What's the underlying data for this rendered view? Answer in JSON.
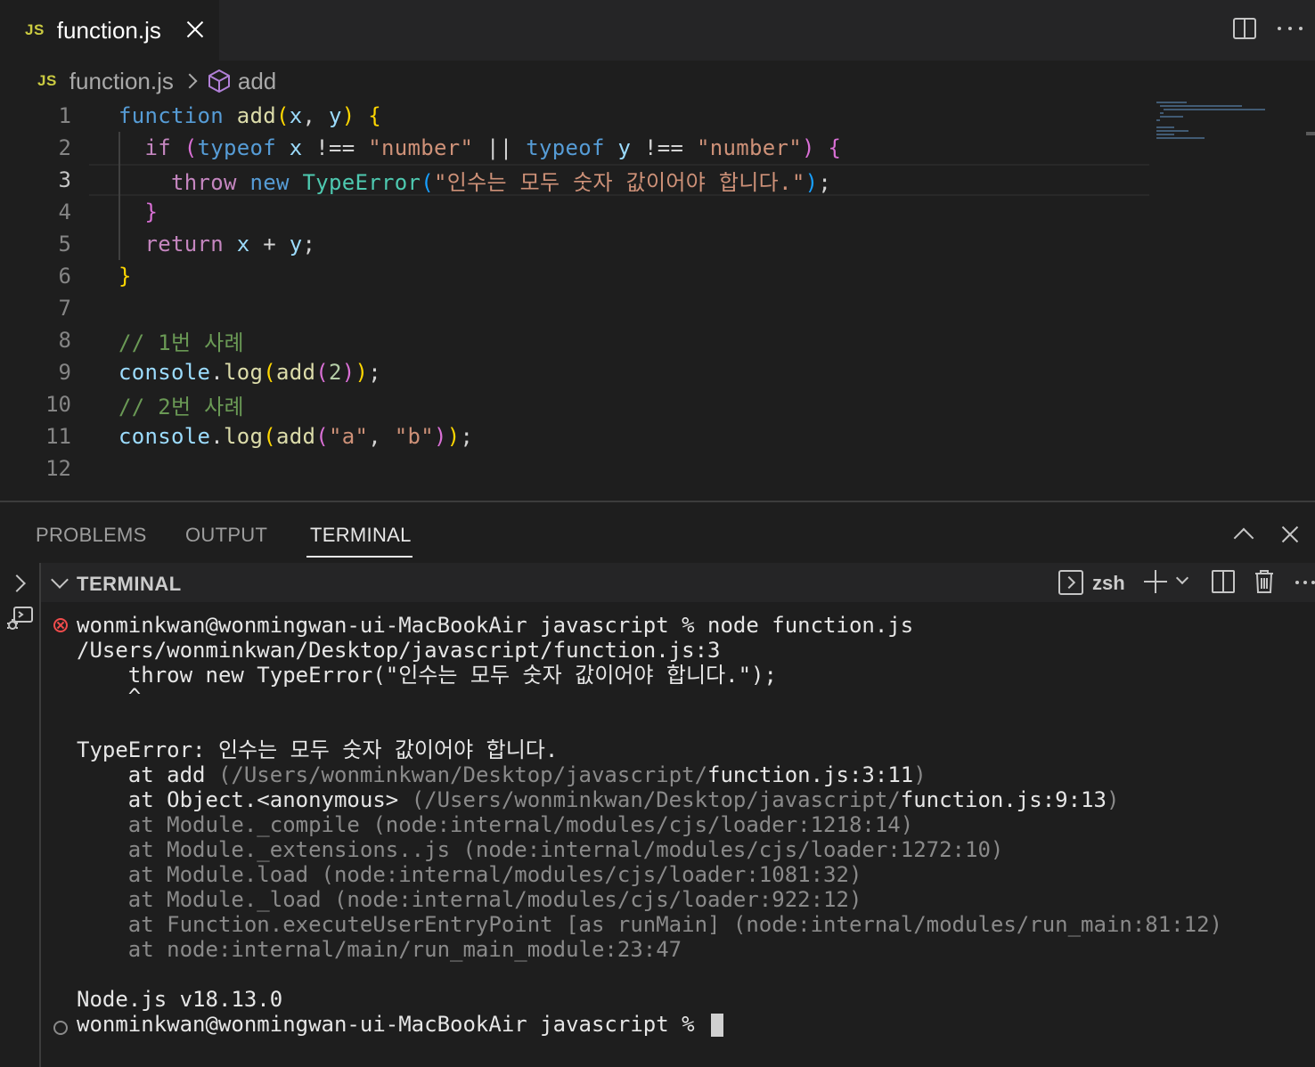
{
  "tab": {
    "badge": "JS",
    "title": "function.js"
  },
  "breadcrumb": {
    "badge": "JS",
    "file": "function.js",
    "symbol": "add"
  },
  "editor": {
    "lines": [
      "1",
      "2",
      "3",
      "4",
      "5",
      "6",
      "7",
      "8",
      "9",
      "10",
      "11",
      "12"
    ],
    "active_line": "3",
    "code": {
      "l1": {
        "kw": "function",
        "fn": "add",
        "p1": "(",
        "x": "x",
        "comma": ", ",
        "y": "y",
        "p2": ")",
        "sp": " ",
        "brace": "{"
      },
      "l2": {
        "indent": "  ",
        "if": "if",
        "sp": " ",
        "p1": "(",
        "typeof1": "typeof",
        "x": "x",
        "op1": " !== ",
        "str1": "\"number\"",
        "or": " || ",
        "typeof2": "typeof",
        "y": "y",
        "op2": " !== ",
        "str2": "\"number\"",
        "p2": ")",
        "brace": "{"
      },
      "l3": {
        "indent": "    ",
        "throw": "throw",
        "new": "new",
        "cls": "TypeError",
        "p1": "(",
        "str": "\"인수는 모두 숫자 값이어야 합니다.\"",
        "p2": ")",
        "semi": ";"
      },
      "l4": {
        "indent": "  ",
        "brace": "}"
      },
      "l5": {
        "indent": "  ",
        "ret": "return",
        "x": "x",
        "plus": " + ",
        "y": "y",
        "semi": ";"
      },
      "l6": {
        "brace": "}"
      },
      "l8": {
        "comment": "// 1번 사례"
      },
      "l9": {
        "obj": "console",
        "dot": ".",
        "log": "log",
        "p1": "(",
        "add": "add",
        "p2": "(",
        "num": "2",
        "p3": ")",
        "p4": ")",
        "semi": ";"
      },
      "l10": {
        "comment": "// 2번 사례"
      },
      "l11": {
        "obj": "console",
        "dot": ".",
        "log": "log",
        "p1": "(",
        "add": "add",
        "p2": "(",
        "a": "\"a\"",
        "comma": ", ",
        "b": "\"b\"",
        "p3": ")",
        "p4": ")",
        "semi": ";"
      }
    }
  },
  "panel": {
    "tabs": [
      "PROBLEMS",
      "OUTPUT",
      "TERMINAL"
    ],
    "active_tab": "TERMINAL",
    "terminal_title": "TERMINAL",
    "shell": "zsh"
  },
  "terminal": {
    "prompt1": "wonminkwan@wonmingwan-ui-MacBookAir javascript % node function.js",
    "path": "/Users/wonminkwan/Desktop/javascript/function.js:3",
    "code_line": "    throw new TypeError(\"인수는 모두 숫자 값이어야 합니다.\");",
    "caret": "    ^",
    "error": "TypeError: 인수는 모두 숫자 값이어야 합니다.",
    "stack": [
      {
        "pre": "    at add ",
        "dim": "(/Users/wonminkwan/Desktop/javascript/",
        "bright": "function.js:3:11",
        "end": ")"
      },
      {
        "pre": "    at Object.<anonymous> ",
        "dim": "(/Users/wonminkwan/Desktop/javascript/",
        "bright": "function.js:9:13",
        "end": ")"
      },
      {
        "dim_full": "    at Module._compile (node:internal/modules/cjs/loader:1218:14)"
      },
      {
        "dim_full": "    at Module._extensions..js (node:internal/modules/cjs/loader:1272:10)"
      },
      {
        "dim_full": "    at Module.load (node:internal/modules/cjs/loader:1081:32)"
      },
      {
        "dim_full": "    at Module._load (node:internal/modules/cjs/loader:922:12)"
      },
      {
        "dim_full": "    at Function.executeUserEntryPoint [as runMain] (node:internal/modules/run_main:81:12)"
      },
      {
        "dim_full": "    at node:internal/main/run_main_module:23:47"
      }
    ],
    "node_version": "Node.js v18.13.0",
    "prompt2": "wonminkwan@wonmingwan-ui-MacBookAir javascript % "
  },
  "colors": {
    "keyword": "#569cd6",
    "control": "#c586c0",
    "function": "#dcdcaa",
    "variable": "#9cdcfe",
    "string": "#ce9178",
    "number": "#b5cea8",
    "class": "#4ec9b0",
    "comment": "#6a9955",
    "error": "#f14c4c"
  },
  "icons": [
    "js-file-icon",
    "close-icon",
    "split-editor-icon",
    "more-icon",
    "chevron-right-icon",
    "symbol-method-icon",
    "chevron-up-icon",
    "terminal-shell-icon",
    "plus-icon",
    "split-terminal-icon",
    "trash-icon",
    "error-icon"
  ]
}
